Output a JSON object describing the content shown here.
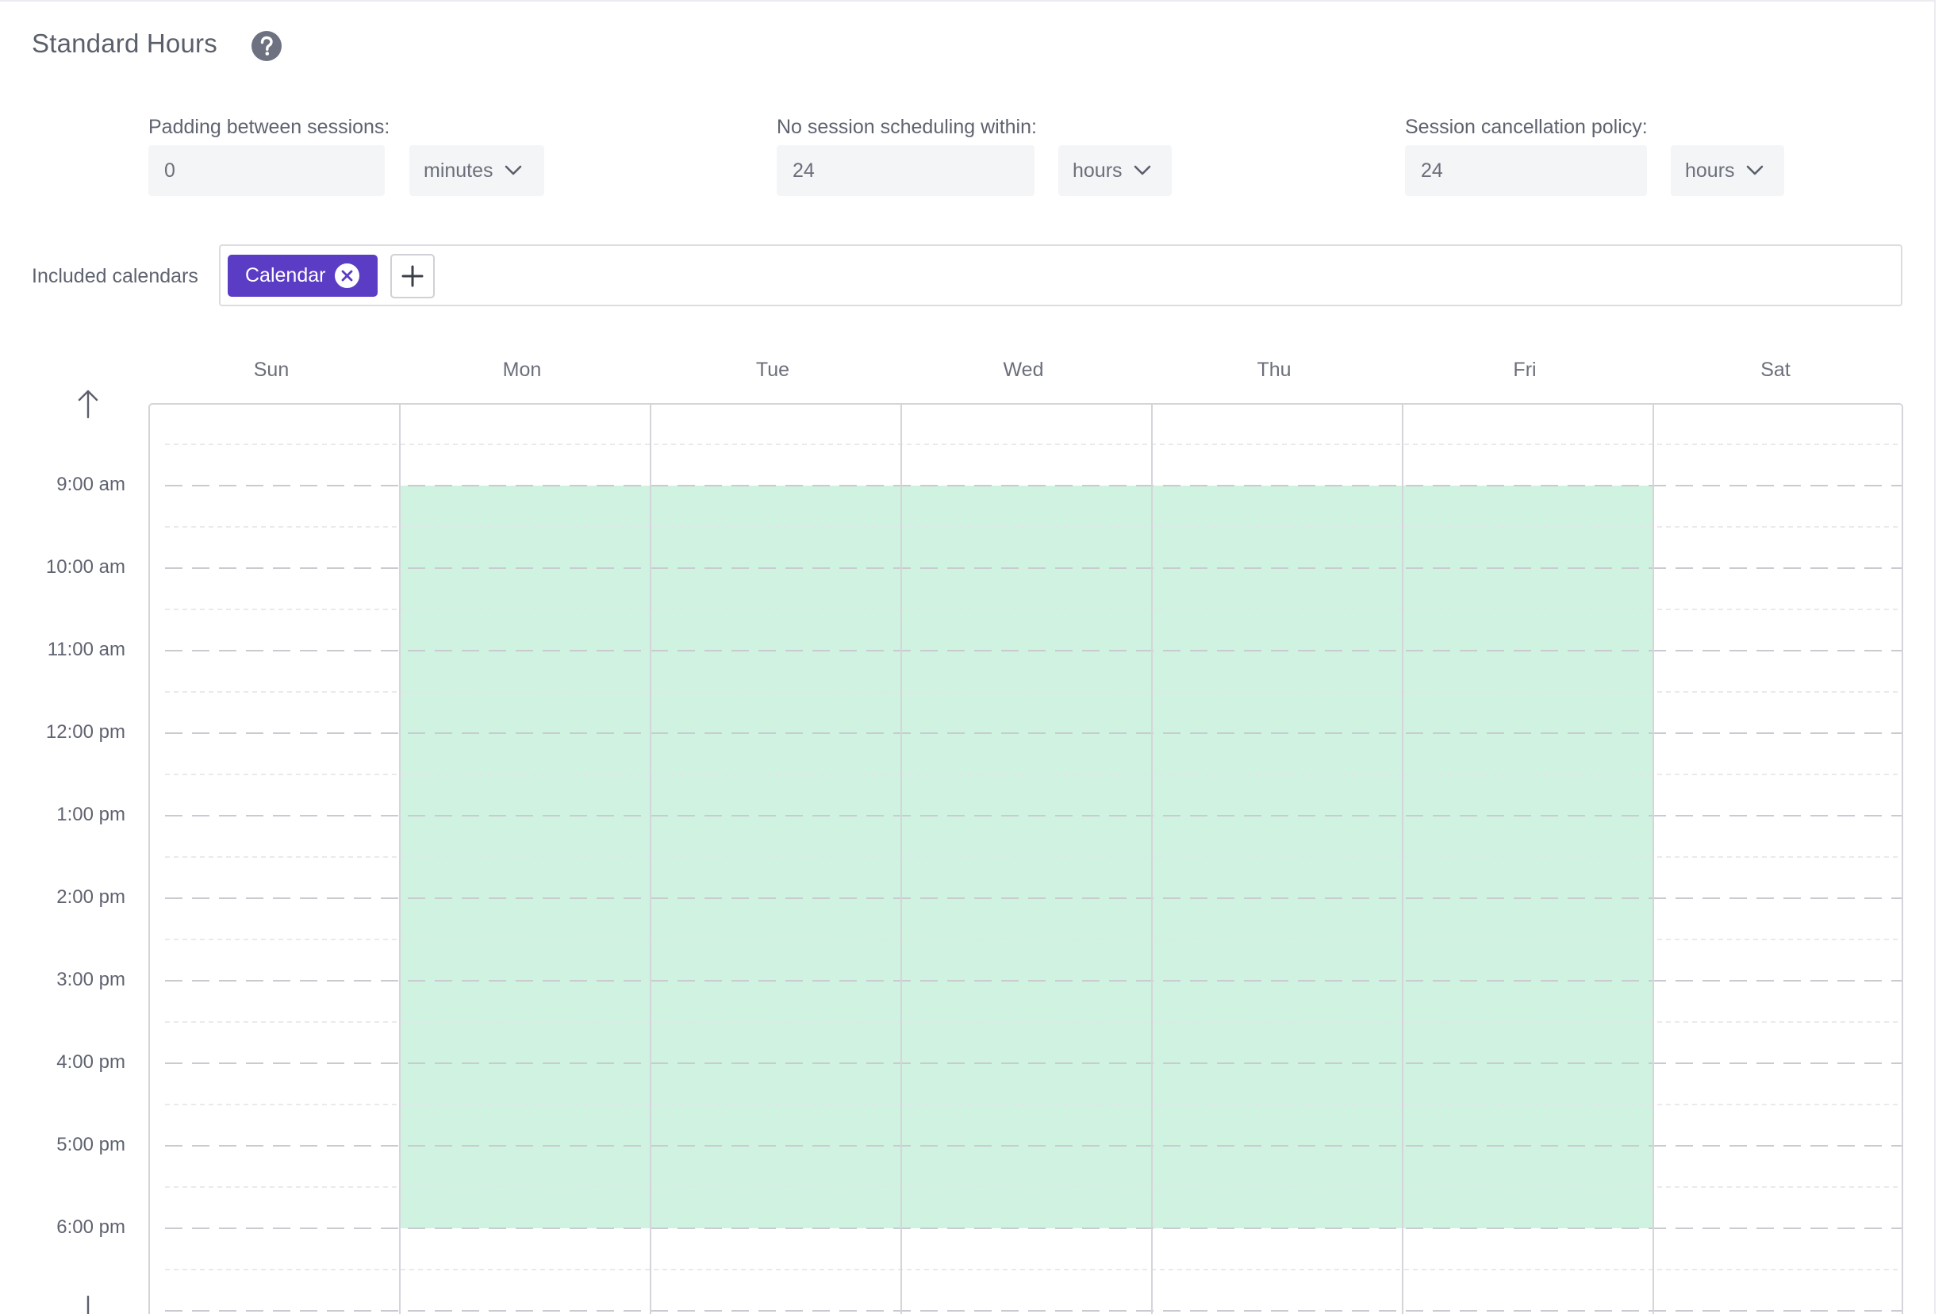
{
  "header": {
    "title": "Standard Hours",
    "help_icon": "question-circle-icon"
  },
  "settings": {
    "padding": {
      "label": "Padding between sessions:",
      "value": "0",
      "unit": "minutes"
    },
    "no_scheduling": {
      "label": "No session scheduling within:",
      "value": "24",
      "unit": "hours"
    },
    "cancellation": {
      "label": "Session cancellation policy:",
      "value": "24",
      "unit": "hours"
    }
  },
  "calendars": {
    "label": "Included calendars",
    "chips": [
      "Calendar"
    ],
    "add_icon": "plus-icon",
    "remove_icon": "close-circle-icon"
  },
  "schedule": {
    "days": [
      "Sun",
      "Mon",
      "Tue",
      "Wed",
      "Thu",
      "Fri",
      "Sat"
    ],
    "times": [
      "9:00 am",
      "10:00 am",
      "11:00 am",
      "12:00 pm",
      "1:00 pm",
      "2:00 pm",
      "3:00 pm",
      "4:00 pm",
      "5:00 pm",
      "6:00 pm"
    ],
    "available": {
      "days": [
        "Mon",
        "Tue",
        "Wed",
        "Thu",
        "Fri"
      ],
      "start": "9:00 am",
      "end": "6:00 pm"
    },
    "scroll_up_icon": "arrow-up-icon",
    "scroll_down_icon": "arrow-down-icon"
  },
  "colors": {
    "accent": "#5b3cc4",
    "available_fill": "#d0f2e0",
    "grid_line": "#d4d5da",
    "hour_line": "#c9cbd1"
  }
}
